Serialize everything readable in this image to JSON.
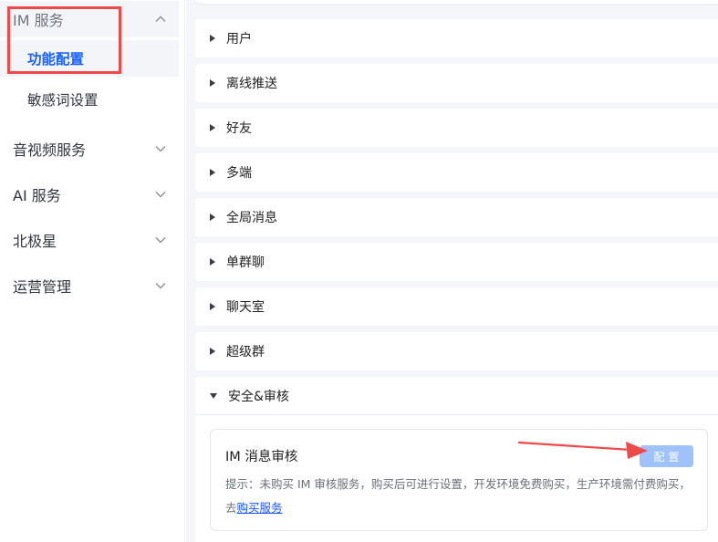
{
  "sidebar": {
    "groups": [
      {
        "label": "IM 服务",
        "expanded": true,
        "children": [
          {
            "label": "功能配置",
            "active": true
          },
          {
            "label": "敏感词设置",
            "active": false
          }
        ]
      },
      {
        "label": "音视频服务",
        "expanded": false
      },
      {
        "label": "AI 服务",
        "expanded": false
      },
      {
        "label": "北极星",
        "expanded": false
      },
      {
        "label": "运营管理",
        "expanded": false
      }
    ]
  },
  "accordion": {
    "items": [
      {
        "label": "用户",
        "expanded": false
      },
      {
        "label": "离线推送",
        "expanded": false
      },
      {
        "label": "好友",
        "expanded": false
      },
      {
        "label": "多端",
        "expanded": false
      },
      {
        "label": "全局消息",
        "expanded": false
      },
      {
        "label": "单群聊",
        "expanded": false
      },
      {
        "label": "聊天室",
        "expanded": false
      },
      {
        "label": "超级群",
        "expanded": false
      },
      {
        "label": "安全&审核",
        "expanded": true
      }
    ]
  },
  "audit_card": {
    "title": "IM 消息审核",
    "config_label": "配置",
    "config_enabled": false,
    "hint_text": "提示：未购买 IM 审核服务，购买后可进行设置，开发环境免费购买，生产环境需付费购买，去",
    "buy_link": "购买服务"
  },
  "colors": {
    "accent": "#1a62ff",
    "annotation": "#ef4a4a",
    "disabled_button": "#9fc2fb",
    "content_bg": "#f4f6f9"
  }
}
